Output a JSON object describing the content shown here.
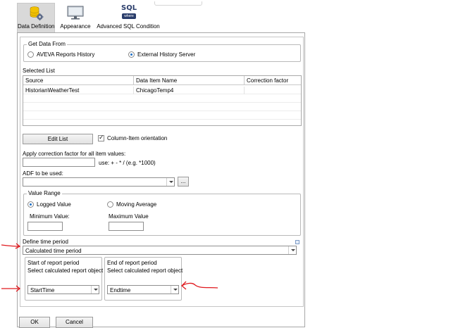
{
  "tabs": [
    {
      "label": "Data Definition",
      "icon": "database-gear-icon",
      "active": true
    },
    {
      "label": "Appearance",
      "icon": "monitor-icon",
      "active": false
    },
    {
      "label": "Advanced SQL Condition",
      "icon": "sql-where-icon",
      "icon_text": "SQL",
      "icon_subtext": "where",
      "active": false
    }
  ],
  "get_data_from": {
    "title": "Get Data From",
    "options": [
      {
        "label": "AVEVA Reports History",
        "selected": false
      },
      {
        "label": "External History Server",
        "selected": true
      }
    ]
  },
  "selected_list": {
    "title": "Selected List",
    "columns": [
      "Source",
      "Data Item Name",
      "Correction factor"
    ],
    "rows": [
      {
        "source": "HistorianWeatherTest",
        "item": "ChicagoTemp4",
        "factor": ""
      }
    ]
  },
  "edit_list_label": "Edit List",
  "column_item": {
    "label": "Column-Item orientation",
    "checked": true
  },
  "correction": {
    "label": "Apply correction factor for all item values:",
    "value": "",
    "hint": "use: + - * /  (e.g. *1000)"
  },
  "adf": {
    "label": "ADF to be used:",
    "value": "",
    "browse_label": "..."
  },
  "value_range": {
    "title": "Value Range",
    "options": [
      {
        "label": "Logged Value",
        "selected": true
      },
      {
        "label": "Moving Average",
        "selected": false
      }
    ],
    "min_label": "Minimum Value:",
    "max_label": "Maximum Value",
    "min_value": "",
    "max_value": ""
  },
  "time_period": {
    "title": "Define time period",
    "selected": "Calculated time period",
    "start": {
      "title": "Start of report period",
      "label": "Select calculated report object",
      "value": "StartTime"
    },
    "end": {
      "title": "End of report period",
      "label": "Select calculated report object",
      "value": "Endtime"
    }
  },
  "buttons": {
    "ok": "OK",
    "cancel": "Cancel"
  },
  "colors": {
    "accent": "#1d6fc7",
    "annotation": "#e0191e",
    "tab_active": "#d9d9d9"
  }
}
